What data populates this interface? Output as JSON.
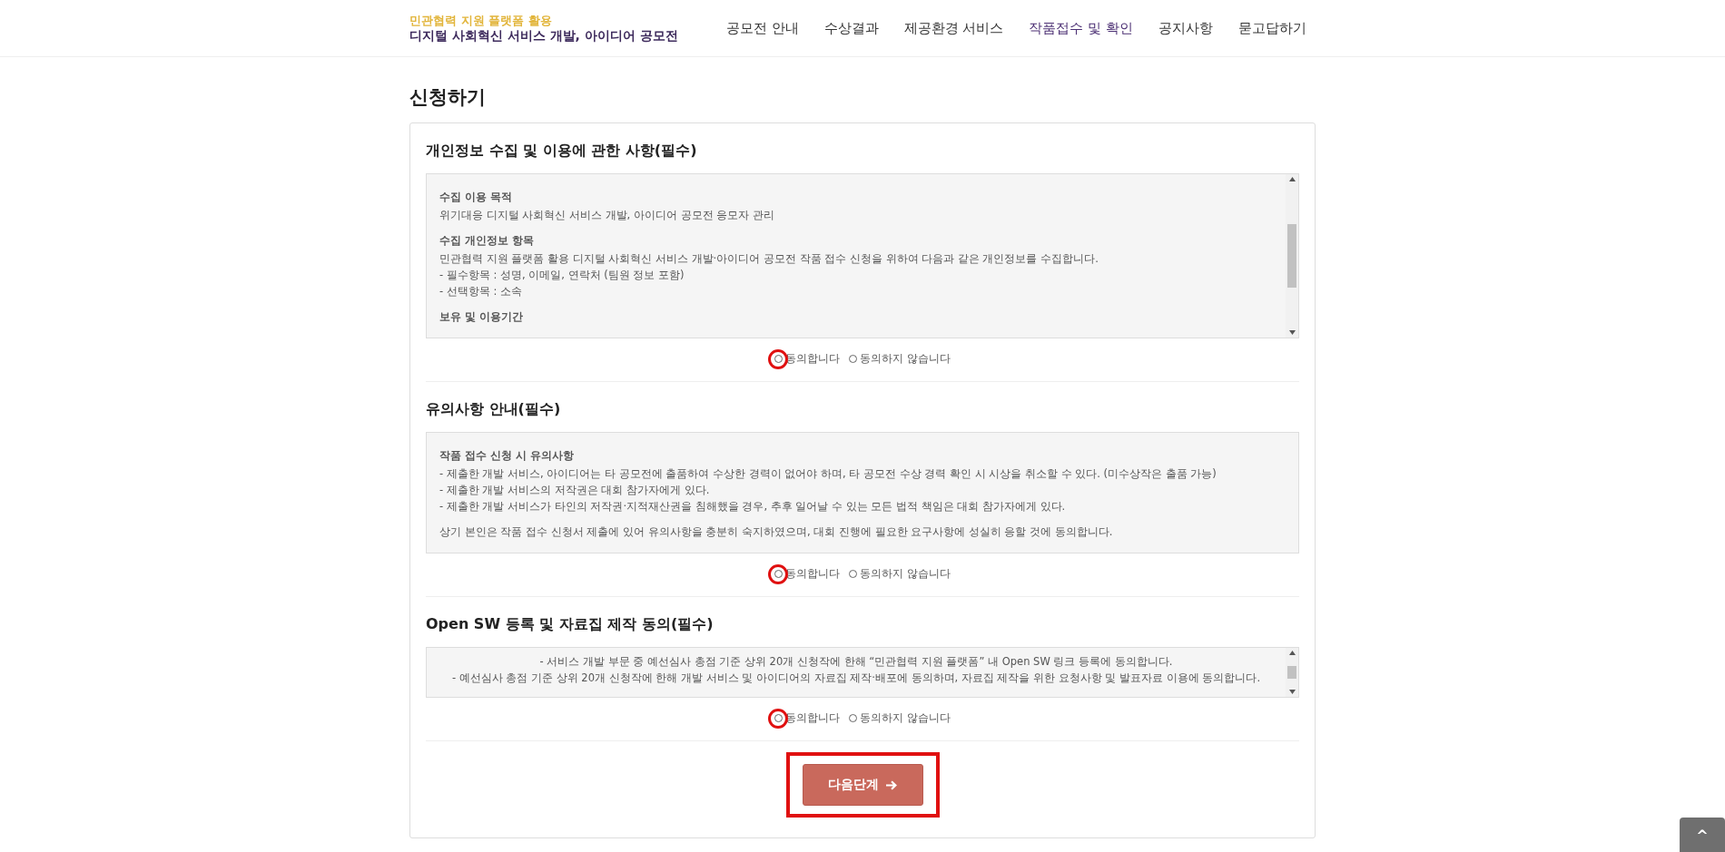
{
  "header": {
    "logo_top": "민관협력 지원 플랫폼 활용",
    "logo_bottom": "디지털 사회혁신 서비스 개발, 아이디어 공모전",
    "nav": [
      {
        "label": "공모전 안내",
        "selected": false
      },
      {
        "label": "수상결과",
        "selected": false
      },
      {
        "label": "제공환경 서비스",
        "selected": false
      },
      {
        "label": "작품접수 및 확인",
        "selected": true
      },
      {
        "label": "공지사항",
        "selected": false
      },
      {
        "label": "묻고답하기",
        "selected": false
      }
    ]
  },
  "page_title": "신청하기",
  "sections": [
    {
      "title": "개인정보 수집 및 이용에 관한 사항(필수)",
      "scrollable": true,
      "centered": false,
      "blocks": [
        {
          "heading": "수집 이용 목적",
          "lines": [
            "위기대응 디지털 사회혁신 서비스 개발, 아이디어 공모전 응모자 관리"
          ]
        },
        {
          "heading": "수집 개인정보 항목",
          "lines": [
            "민관협력 지원 플랫폼 활용 디지털 사회혁신 서비스 개발·아이디어 공모전 작품 접수 신청을 위하여 다음과 같은 개인정보를 수집합니다.",
            "- 필수항목 : 성명, 이메일, 연락처 (팀원 정보 포함)",
            "- 선택항목 : 소속"
          ]
        },
        {
          "heading": "보유 및 이용기간"
        }
      ],
      "options": [
        {
          "label": "동의합니다",
          "selected": false,
          "highlighted": true
        },
        {
          "label": "동의하지 않습니다",
          "selected": false,
          "highlighted": false
        }
      ]
    },
    {
      "title": "유의사항 안내(필수)",
      "scrollable": false,
      "centered": false,
      "blocks": [
        {
          "heading": "작품 접수 신청 시 유의사항",
          "lines": [
            "- 제출한 개발 서비스, 아이디어는 타 공모전에 출품하여 수상한 경력이 없어야 하며, 타 공모전 수상 경력 확인 시 시상을 취소할 수 있다. (미수상작은 출품 가능)",
            "- 제출한 개발 서비스의 저작권은 대회 참가자에게 있다.",
            "- 제출한 개발 서비스가 타인의 저작권·지적재산권을 침해했을 경우, 추후 일어날 수 있는 모든 법적 책임은 대회 참가자에게 있다."
          ]
        },
        {
          "lines": [
            "상기 본인은 작품 접수 신청서 제출에 있어 유의사항을 충분히 숙지하였으며, 대회 진행에 필요한 요구사항에 성실히 응할 것에 동의합니다."
          ]
        }
      ],
      "options": [
        {
          "label": "동의합니다",
          "selected": false,
          "highlighted": true
        },
        {
          "label": "동의하지 않습니다",
          "selected": false,
          "highlighted": false
        }
      ]
    },
    {
      "title": "Open SW 등록 및 자료집 제작 동의(필수)",
      "scrollable": true,
      "centered": true,
      "blocks": [
        {
          "lines": [
            "- 서비스 개발 부문 중 예선심사 총점 기준 상위 20개 신청작에 한해 “민관협력 지원 플랫폼” 내 Open SW 링크 등록에 동의합니다.",
            "- 예선심사 총점 기준 상위 20개 신청작에 한해 개발 서비스 및 아이디어의 자료집 제작·배포에 동의하며, 자료집 제작을 위한 요청사항 및 발표자료 이용에 동의합니다."
          ]
        }
      ],
      "options": [
        {
          "label": "동의합니다",
          "selected": false,
          "highlighted": true
        },
        {
          "label": "동의하지 않습니다",
          "selected": false,
          "highlighted": false
        }
      ]
    }
  ],
  "next_button": {
    "label": "다음단계",
    "highlighted": true
  },
  "scroll_top": {
    "label": "^"
  }
}
